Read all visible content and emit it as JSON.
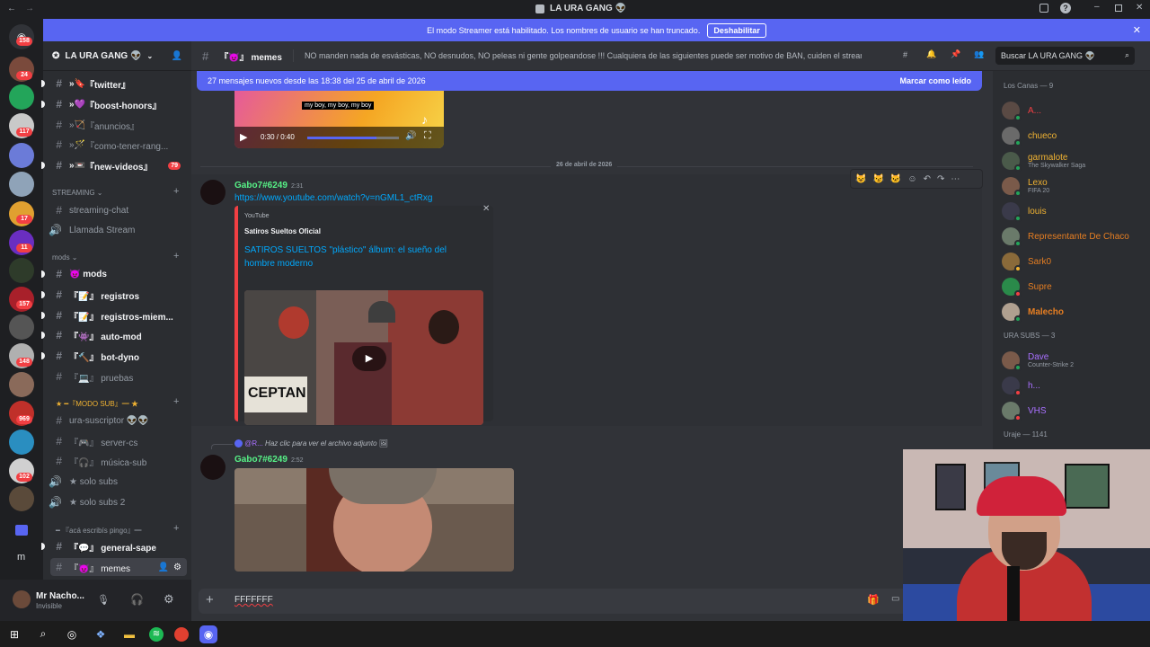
{
  "window": {
    "title": "LA URA GANG 👽"
  },
  "streamer_notice": {
    "text": "El modo Streamer está habilitado. Los nombres de usuario se han truncado.",
    "button": "Deshabilitar"
  },
  "guild_badges": [
    "158",
    "24",
    "117",
    "17",
    "11",
    "157",
    "148",
    "969",
    "102"
  ],
  "server": {
    "name": "LA URA GANG 👽"
  },
  "channels": [
    {
      "prefix": "»🔖",
      "label": "『twitter』",
      "unread": true
    },
    {
      "prefix": "»💜",
      "label": "『boost-honors』",
      "unread": true
    },
    {
      "prefix": "»🏹",
      "label": "『anuncios』",
      "unread": false
    },
    {
      "prefix": "»🪄",
      "label": "『como-tener-rang...",
      "unread": false
    },
    {
      "prefix": "»📼",
      "label": "『new-videos』",
      "unread": true,
      "badge": "79"
    }
  ],
  "categories": {
    "streaming": "STREAMING",
    "mods": "mods",
    "modo_sub": "★ ━『MODO SUB』━ ★",
    "acaescribis": "━ 『acá escribís pingo』━"
  },
  "streaming_channels": [
    {
      "label": "streaming-chat",
      "icon": "#"
    },
    {
      "label": "Llamada Stream",
      "icon": "🔊"
    }
  ],
  "mods_channels": [
    {
      "label": "😈 mods",
      "unread": true
    },
    {
      "label": "『📝』 registros",
      "unread": true
    },
    {
      "label": "『📝』 registros-miem...",
      "unread": true
    },
    {
      "label": "『👾』 auto-mod",
      "unread": true
    },
    {
      "label": "『🔨』 bot-dyno",
      "unread": true
    },
    {
      "label": "『💻』 pruebas",
      "unread": false
    }
  ],
  "sub_channels": [
    {
      "label": "ura-suscriptor 👽👽",
      "icon": "#"
    },
    {
      "label": "『🎮』 server-cs",
      "icon": "#"
    },
    {
      "label": "『🎧』 música-sub",
      "icon": "#"
    },
    {
      "label": "★ solo subs",
      "icon": "🔊"
    },
    {
      "label": "★ solo subs 2",
      "icon": "🔊"
    }
  ],
  "chat_channels": [
    {
      "label": "『💬』 general-sape",
      "unread": true
    },
    {
      "label": "『😈』 memes",
      "active": true
    }
  ],
  "user": {
    "name": "Mr Nacho...",
    "status": "Invisible"
  },
  "channel_header": {
    "name": "『😈』 memes",
    "topic": "NO manden nada de esvásticas, NO desnudos, NO peleas ni gente golpeandose !!! Cualquiera de las siguientes puede ser motivo de BAN, cuiden el stream!",
    "search_placeholder": "Buscar LA URA GANG 👽"
  },
  "new_messages": {
    "text": "27 mensajes nuevos desde las 18:38 del 25 de abril de 2026",
    "action": "Marcar como leído"
  },
  "video": {
    "caption": "my boy, my boy, my boy",
    "time": "0:30 / 0:40",
    "progress": 0.75
  },
  "date_divider": "26 de abril de 2026",
  "messages": [
    {
      "author": "Gabo7#6249",
      "time": "2:31",
      "link": "https://www.youtube.com/watch?v=nGML1_ctRxg",
      "embed": {
        "provider": "YouTube",
        "author": "Satiros Sueltos Oficial",
        "title": "SATIROS SUELTOS \"plástico\" álbum: el sueño del hombre moderno",
        "thumb_text": "CEPTAN"
      }
    },
    {
      "reply": {
        "user": "@R...",
        "text": "Haz clic para ver el archivo adjunto"
      },
      "author": "Gabo7#6249",
      "time": "2:52"
    }
  ],
  "composer": {
    "text": "FFFFFFF"
  },
  "member_groups": [
    {
      "title": "Los Canas — 9",
      "members": [
        {
          "name": "A...",
          "color": "#f23f43",
          "status": "#23a55a"
        },
        {
          "name": "chueco",
          "color": "#f0b232",
          "status": "#23a55a"
        },
        {
          "name": "garmalote",
          "color": "#f0b232",
          "status": "#23a55a",
          "activity": "The Skywalker Saga"
        },
        {
          "name": "Lexo",
          "color": "#f0b232",
          "status": "#23a55a",
          "activity": "FIFA 20"
        },
        {
          "name": "louis",
          "color": "#f0b232",
          "status": "#23a55a"
        },
        {
          "name": "Representante De Chaco",
          "color": "#e67e22",
          "status": "#23a55a"
        },
        {
          "name": "Sark0",
          "color": "#e67e22",
          "status": "#f0b232"
        },
        {
          "name": "Supre",
          "color": "#e67e22",
          "status": "#f23f43"
        },
        {
          "name": "Malecho",
          "color": "#e67e22",
          "status": "#23a55a"
        }
      ]
    },
    {
      "title": "URA SUBS — 3",
      "members": [
        {
          "name": "Dave",
          "color": "#a970ff",
          "status": "#23a55a",
          "activity": "Counter-Strike 2"
        },
        {
          "name": "h...",
          "color": "#a970ff",
          "status": "#f23f43"
        },
        {
          "name": "VHS",
          "color": "#a970ff",
          "status": "#f23f43"
        }
      ]
    },
    {
      "title": "Uraje — 1141"
    }
  ]
}
